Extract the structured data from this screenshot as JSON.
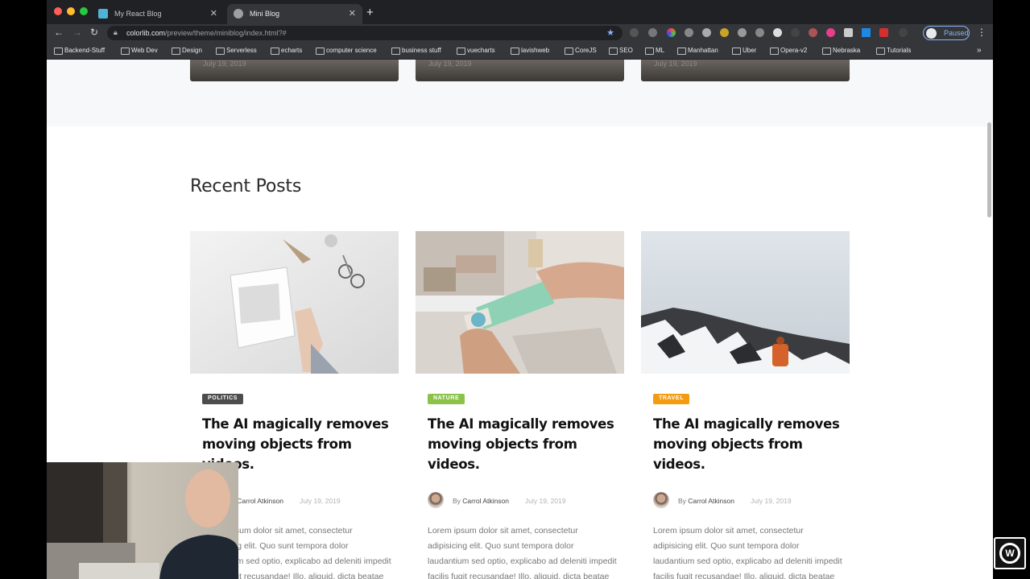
{
  "browser": {
    "tabs": [
      {
        "title": "My React Blog",
        "active": false
      },
      {
        "title": "Mini Blog",
        "active": true
      }
    ],
    "url_host": "colorlib.com",
    "url_path": "/preview/theme/miniblog/index.html?#",
    "profile_label": "Paused",
    "bookmarks": [
      "Backend-Stuff",
      "Web Dev",
      "Design",
      "Serverless",
      "echarts",
      "computer science",
      "business stuff",
      "vuecharts",
      "lavishweb",
      "CoreJS",
      "SEO",
      "ML",
      "Manhattan",
      "Uber",
      "Opera-v2",
      "Nebraska",
      "Tutorials"
    ]
  },
  "top_cards": [
    {
      "date": "July 19, 2019"
    },
    {
      "date": "July 19, 2019"
    },
    {
      "date": "July 19, 2019"
    }
  ],
  "recent": {
    "title": "Recent Posts",
    "posts": [
      {
        "category": "POLITICS",
        "category_color": "#4d4d4d",
        "title": "The AI magically removes moving objects from videos.",
        "author_prefix": "By",
        "author": "Carrol Atkinson",
        "date": "July 19, 2019",
        "excerpt": "Lorem ipsum dolor sit amet, consectetur adipisicing elit. Quo sunt tempora dolor laudantium sed optio, explicabo ad deleniti impedit facilis fugit recusandae! Illo, aliquid, dicta beatae quia porro id est."
      },
      {
        "category": "NATURE",
        "category_color": "#8bc34a",
        "title": "The AI magically removes moving objects from videos.",
        "author_prefix": "By",
        "author": "Carrol Atkinson",
        "date": "July 19, 2019",
        "excerpt": "Lorem ipsum dolor sit amet, consectetur adipisicing elit. Quo sunt tempora dolor laudantium sed optio, explicabo ad deleniti impedit facilis fugit recusandae! Illo, aliquid, dicta beatae quia porro id est."
      },
      {
        "category": "TRAVEL",
        "category_color": "#f39c12",
        "title": "The AI magically removes moving objects from videos.",
        "author_prefix": "By",
        "author": "Carrol Atkinson",
        "date": "July 19, 2019",
        "excerpt": "Lorem ipsum dolor sit amet, consectetur adipisicing elit. Quo sunt tempora dolor laudantium sed optio, explicabo ad deleniti impedit facilis fugit recusandae! Illo, aliquid, dicta beatae quia porro id est."
      }
    ]
  }
}
